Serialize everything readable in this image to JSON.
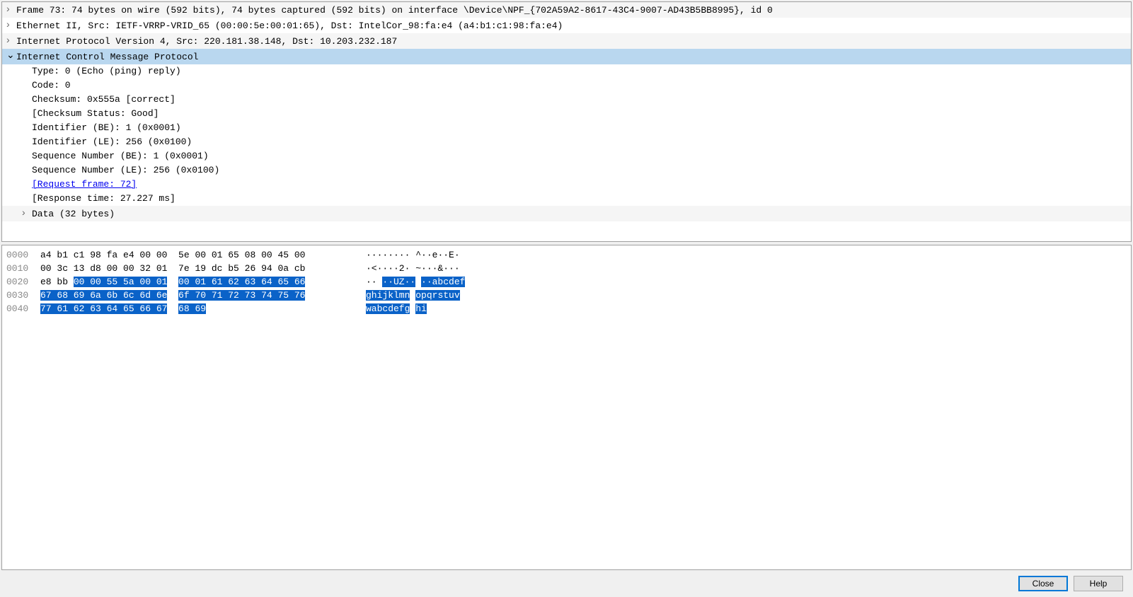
{
  "details": {
    "frame": "Frame 73: 74 bytes on wire (592 bits), 74 bytes captured (592 bits) on interface \\Device\\NPF_{702A59A2-8617-43C4-9007-AD43B5BB8995}, id 0",
    "ethernet": "Ethernet II, Src: IETF-VRRP-VRID_65 (00:00:5e:00:01:65), Dst: IntelCor_98:fa:e4 (a4:b1:c1:98:fa:e4)",
    "ip": "Internet Protocol Version 4, Src: 220.181.38.148, Dst: 10.203.232.187",
    "icmp_header": "Internet Control Message Protocol",
    "icmp": {
      "type": "Type: 0 (Echo (ping) reply)",
      "code": "Code: 0",
      "checksum": "Checksum: 0x555a [correct]",
      "checksum_status": "[Checksum Status: Good]",
      "id_be": "Identifier (BE): 1 (0x0001)",
      "id_le": "Identifier (LE): 256 (0x0100)",
      "seq_be": "Sequence Number (BE): 1 (0x0001)",
      "seq_le": "Sequence Number (LE): 256 (0x0100)",
      "request_frame": "[Request frame: 72]",
      "response_time": "[Response time: 27.227 ms]",
      "data": "Data (32 bytes)"
    }
  },
  "hex": {
    "rows": [
      {
        "offset": "0000",
        "bytes_a": "a4 b1 c1 98 fa e4 00 00",
        "bytes_b": "5e 00 01 65 08 00 45 00",
        "ascii_a": "········",
        "ascii_b": "^··e··E·"
      },
      {
        "offset": "0010",
        "bytes_a": "00 3c 13 d8 00 00 32 01",
        "bytes_b": "7e 19 dc b5 26 94 0a cb",
        "ascii_a": "·<····2·",
        "ascii_b": "~···&···"
      },
      {
        "offset": "0020",
        "pre_bytes": "e8 bb ",
        "hl_bytes_a": "00 00 55 5a 00 01",
        "hl_bytes_b": "00 01 61 62 63 64 65 66",
        "ascii_pre": "·· ",
        "ascii_hl_a": "··UZ··",
        "ascii_mid": " ",
        "ascii_hl_b": "··abcdef"
      },
      {
        "offset": "0030",
        "hl_bytes_a": "67 68 69 6a 6b 6c 6d 6e",
        "hl_bytes_b": "6f 70 71 72 73 74 75 76",
        "ascii_hl_a": "ghijklmn",
        "ascii_mid": " ",
        "ascii_hl_b": "opqrstuv"
      },
      {
        "offset": "0040",
        "hl_bytes_a": "77 61 62 63 64 65 66 67",
        "hl_bytes_b": "68 69",
        "ascii_hl_a": "wabcdefg",
        "ascii_mid": " ",
        "ascii_hl_b": "hi"
      }
    ]
  },
  "buttons": {
    "close": "Close",
    "help": "Help"
  }
}
